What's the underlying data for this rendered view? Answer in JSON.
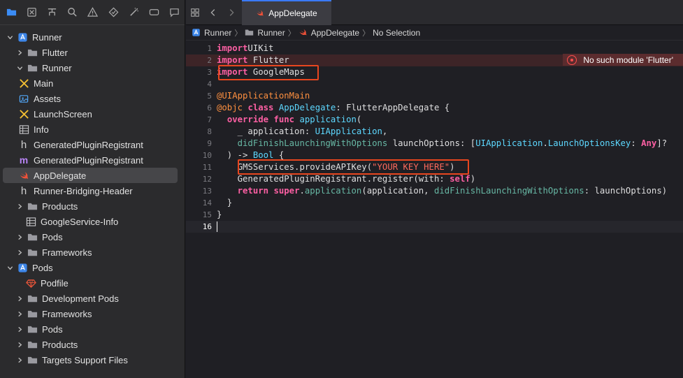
{
  "sidebar": {
    "toolbar_icons": [
      "folder-icon",
      "source-control-icon",
      "hierarchy-icon",
      "search-icon",
      "warning-icon",
      "test-icon",
      "debug-icon",
      "breakpoint-icon",
      "report-icon"
    ],
    "tree": [
      {
        "label": "Runner",
        "level": 0,
        "expanded": true,
        "icon": "xcode-project-icon"
      },
      {
        "label": "Flutter",
        "level": 1,
        "expanded": false,
        "icon": "folder-icon"
      },
      {
        "label": "Runner",
        "level": 1,
        "expanded": true,
        "icon": "folder-icon"
      },
      {
        "label": "Main",
        "level": 2,
        "icon": "storyboard-icon"
      },
      {
        "label": "Assets",
        "level": 2,
        "icon": "assets-icon"
      },
      {
        "label": "LaunchScreen",
        "level": 2,
        "icon": "storyboard-icon"
      },
      {
        "label": "Info",
        "level": 2,
        "icon": "plist-icon"
      },
      {
        "label": "GeneratedPluginRegistrant",
        "level": 2,
        "icon": "header-file-icon"
      },
      {
        "label": "GeneratedPluginRegistrant",
        "level": 2,
        "icon": "objc-file-icon"
      },
      {
        "label": "AppDelegate",
        "level": 2,
        "icon": "swift-file-icon",
        "selected": true
      },
      {
        "label": "Runner-Bridging-Header",
        "level": 2,
        "icon": "header-file-icon"
      },
      {
        "label": "Products",
        "level": 1,
        "expanded": false,
        "icon": "folder-icon"
      },
      {
        "label": "GoogleService-Info",
        "level": 1,
        "icon": "plist-icon"
      },
      {
        "label": "Pods",
        "level": 1,
        "expanded": false,
        "icon": "folder-icon"
      },
      {
        "label": "Frameworks",
        "level": 1,
        "expanded": false,
        "icon": "folder-icon"
      },
      {
        "label": "Pods",
        "level": 0,
        "expanded": true,
        "icon": "xcode-project-icon"
      },
      {
        "label": "Podfile",
        "level": 1,
        "icon": "ruby-file-icon"
      },
      {
        "label": "Development Pods",
        "level": 1,
        "expanded": false,
        "icon": "folder-icon"
      },
      {
        "label": "Frameworks",
        "level": 1,
        "expanded": false,
        "icon": "folder-icon"
      },
      {
        "label": "Pods",
        "level": 1,
        "expanded": false,
        "icon": "folder-icon"
      },
      {
        "label": "Products",
        "level": 1,
        "expanded": false,
        "icon": "folder-icon"
      },
      {
        "label": "Targets Support Files",
        "level": 1,
        "expanded": false,
        "icon": "folder-icon"
      }
    ]
  },
  "editor": {
    "tab_label": "AppDelegate",
    "breadcrumb": [
      "Runner",
      "Runner",
      "AppDelegate",
      "No Selection"
    ],
    "error_message": "No such module 'Flutter'",
    "current_line": 16,
    "lines": [
      {
        "n": 1,
        "tokens": [
          [
            "kw",
            "import"
          ],
          [
            "",
            "UIKit"
          ]
        ]
      },
      {
        "n": 2,
        "tokens": [
          [
            "kw",
            "import"
          ],
          [
            "",
            " Flutter"
          ]
        ],
        "error": true
      },
      {
        "n": 3,
        "tokens": [
          [
            "kw",
            "import"
          ],
          [
            "",
            " GoogleMaps"
          ]
        ]
      },
      {
        "n": 4,
        "tokens": []
      },
      {
        "n": 5,
        "tokens": [
          [
            "at",
            "@UIApplicationMain"
          ]
        ]
      },
      {
        "n": 6,
        "tokens": [
          [
            "at",
            "@objc"
          ],
          [
            "",
            " "
          ],
          [
            "kw",
            "class"
          ],
          [
            "",
            " "
          ],
          [
            "ty",
            "AppDelegate"
          ],
          [
            "",
            ": FlutterAppDelegate {"
          ]
        ]
      },
      {
        "n": 7,
        "tokens": [
          [
            "",
            "  "
          ],
          [
            "kw",
            "override"
          ],
          [
            "",
            " "
          ],
          [
            "kw",
            "func"
          ],
          [
            "",
            " "
          ],
          [
            "ty",
            "application"
          ],
          [
            "",
            "("
          ]
        ]
      },
      {
        "n": 8,
        "tokens": [
          [
            "",
            "    _ application: "
          ],
          [
            "ty",
            "UIApplication"
          ],
          [
            "",
            ","
          ]
        ]
      },
      {
        "n": 9,
        "tokens": [
          [
            "",
            "    "
          ],
          [
            "fn",
            "didFinishLaunchingWithOptions"
          ],
          [
            "",
            " launchOptions: ["
          ],
          [
            "ty",
            "UIApplication"
          ],
          [
            "",
            "."
          ],
          [
            "ty",
            "LaunchOptionsKey"
          ],
          [
            "",
            ": "
          ],
          [
            "kw",
            "Any"
          ],
          [
            "",
            "]?"
          ]
        ]
      },
      {
        "n": 10,
        "tokens": [
          [
            "",
            "  ) -> "
          ],
          [
            "ty",
            "Bool"
          ],
          [
            "",
            " {"
          ]
        ]
      },
      {
        "n": 11,
        "tokens": [
          [
            "",
            "    GMSServices.provideAPIKey("
          ],
          [
            "str",
            "\"YOUR KEY HERE\""
          ],
          [
            "",
            ")"
          ]
        ]
      },
      {
        "n": 12,
        "tokens": [
          [
            "",
            "    GeneratedPluginRegistrant.register(with: "
          ],
          [
            "kw",
            "self"
          ],
          [
            "",
            ")"
          ]
        ]
      },
      {
        "n": 13,
        "tokens": [
          [
            "",
            "    "
          ],
          [
            "kw",
            "return"
          ],
          [
            "",
            " "
          ],
          [
            "kw",
            "super"
          ],
          [
            "",
            "."
          ],
          [
            "fn",
            "application"
          ],
          [
            "",
            "(application, "
          ],
          [
            "fn",
            "didFinishLaunchingWithOptions"
          ],
          [
            "",
            ": launchOptions)"
          ]
        ]
      },
      {
        "n": 14,
        "tokens": [
          [
            "",
            "  }"
          ]
        ]
      },
      {
        "n": 15,
        "tokens": [
          [
            "",
            "}"
          ]
        ]
      },
      {
        "n": 16,
        "tokens": [],
        "cursor": true
      }
    ]
  },
  "colors": {
    "highlight_box": "#e8461f",
    "error_line_bg": "#3d2427",
    "selection_bg": "#464649"
  }
}
